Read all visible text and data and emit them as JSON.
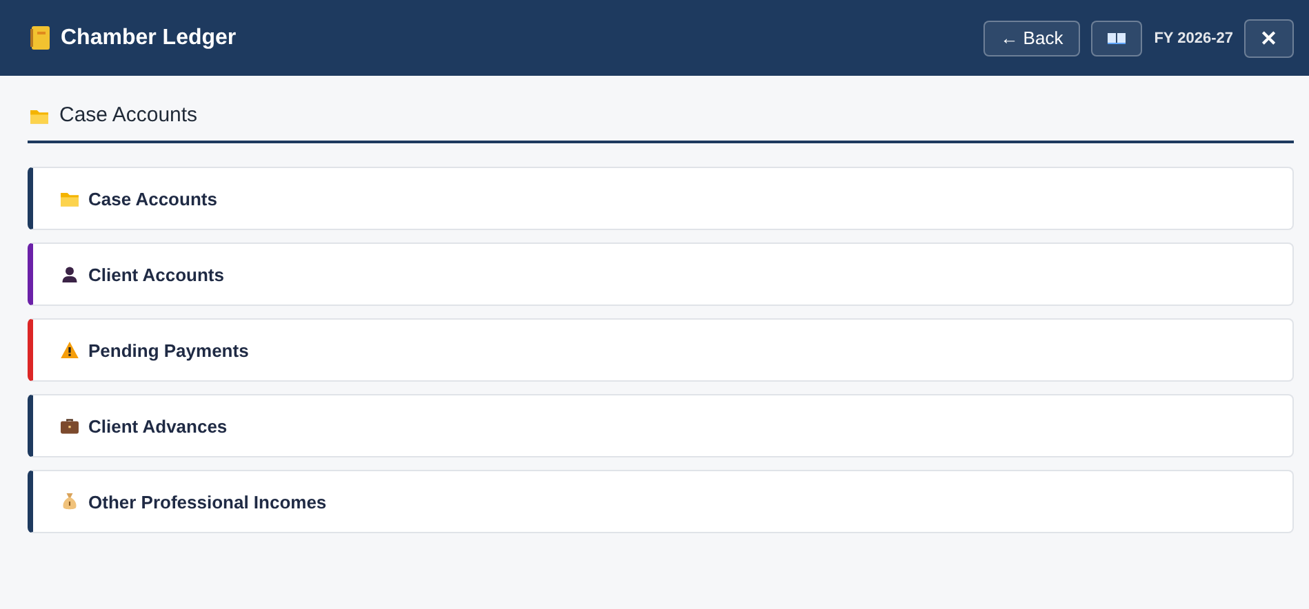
{
  "header": {
    "title": "Chamber Ledger",
    "back_label": "← Back",
    "fiscal_year": "FY 2026-27",
    "close_label": "✕"
  },
  "section": {
    "title": "Case Accounts"
  },
  "items": [
    {
      "label": "Case Accounts",
      "kind": "folder",
      "color": "#1e3a5f"
    },
    {
      "label": "Client Accounts",
      "kind": "person",
      "color": "#6b21a8"
    },
    {
      "label": "Pending Payments",
      "kind": "warning",
      "color": "#dc2626"
    },
    {
      "label": "Client Advances",
      "kind": "briefcase",
      "color": "#1e3a5f"
    },
    {
      "label": "Other Professional Incomes",
      "kind": "moneybag",
      "color": "#1e3a5f"
    }
  ]
}
